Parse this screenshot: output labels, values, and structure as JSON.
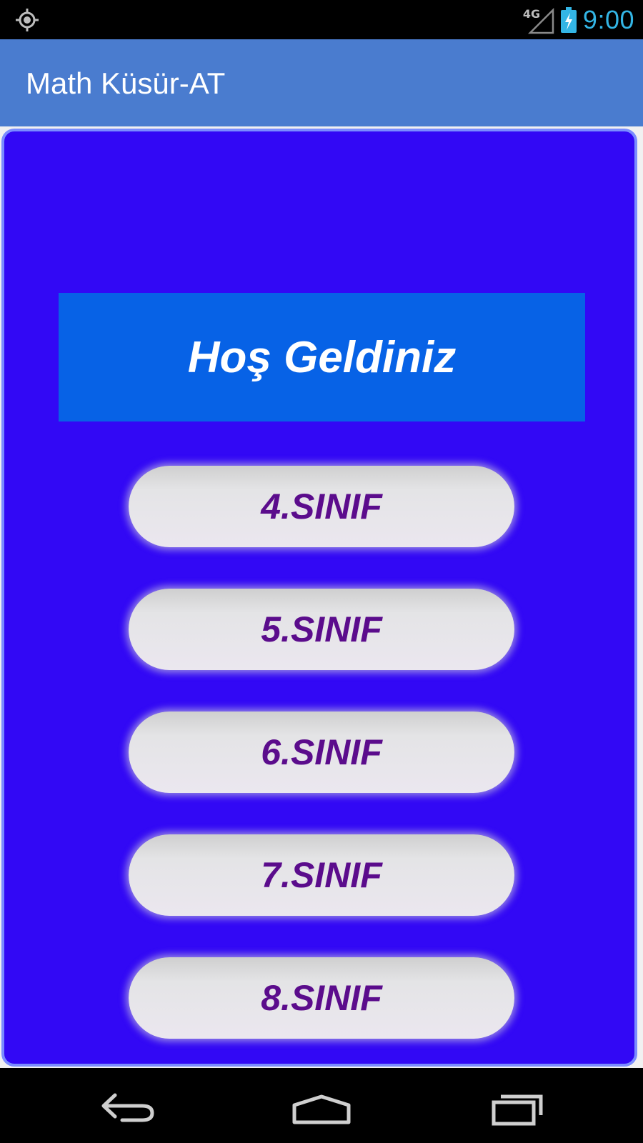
{
  "status_bar": {
    "network": "4G",
    "time": "9:00",
    "left_icon": "location-target-icon",
    "battery_icon": "battery-charging-icon",
    "signal_icon": "signal-icon",
    "clock_color": "#33b5e5"
  },
  "action_bar": {
    "title": "Math Küsür-AT",
    "background": "#4a7ccf"
  },
  "main": {
    "background": "#3208f5",
    "welcome_text": "Hoş Geldiniz",
    "welcome_background": "#0762e6",
    "buttons": [
      {
        "label": "4.SINIF"
      },
      {
        "label": "5.SINIF"
      },
      {
        "label": "6.SINIF"
      },
      {
        "label": "7.SINIF"
      },
      {
        "label": "8.SINIF"
      }
    ],
    "button_text_color": "#5b0c8c"
  },
  "nav_bar": {
    "back_icon": "back-icon",
    "home_icon": "home-icon",
    "recents_icon": "recents-icon"
  }
}
